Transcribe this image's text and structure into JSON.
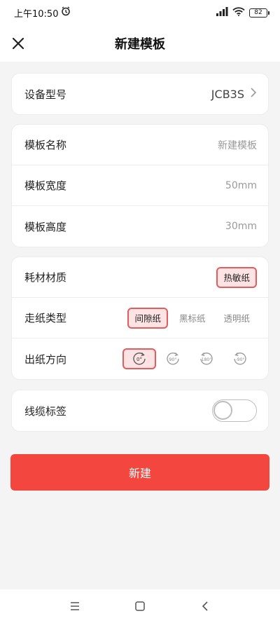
{
  "status_bar": {
    "time": "上午10:50",
    "battery": "82"
  },
  "nav": {
    "title": "新建模板"
  },
  "device": {
    "label": "设备型号",
    "value": "JCB3S"
  },
  "template": {
    "name_label": "模板名称",
    "name_placeholder": "新建模板",
    "width_label": "模板宽度",
    "width_value": "50mm",
    "height_label": "模板高度",
    "height_value": "30mm"
  },
  "paper": {
    "material_label": "耗材材质",
    "material_value": "热敏纸",
    "type_label": "走纸类型",
    "types": [
      "间隙纸",
      "黑标纸",
      "透明纸"
    ],
    "direction_label": "出纸方向",
    "directions": [
      "0°",
      "90°",
      "180°",
      "-90°"
    ]
  },
  "cable": {
    "label": "线缆标签",
    "enabled": false
  },
  "actions": {
    "create_label": "新建"
  },
  "icons": {
    "close": "close-icon",
    "chevron": "chevron-right-icon",
    "alarm": "alarm-icon",
    "signal": "signal-icon",
    "wifi": "wifi-icon",
    "menu": "menu-icon",
    "home": "home-icon",
    "back": "back-icon"
  }
}
